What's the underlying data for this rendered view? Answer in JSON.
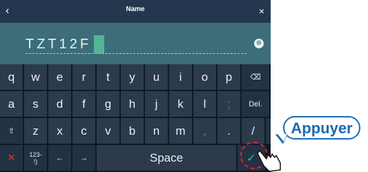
{
  "titlebar": {
    "back_icon": "chevron-left-icon",
    "back_glyph": "‹",
    "title": "Name",
    "close_icon": "close-icon",
    "close_glyph": "×"
  },
  "field": {
    "value": "TZT12F",
    "clear_icon": "clear-circle-icon",
    "clear_glyph": "⊗"
  },
  "keyboard": {
    "row1": [
      "q",
      "w",
      "e",
      "r",
      "t",
      "y",
      "u",
      "i",
      "o",
      "p"
    ],
    "backspace_glyph": "⌫",
    "row2": [
      "a",
      "s",
      "d",
      "f",
      "g",
      "h",
      "j",
      "k",
      "l",
      ";"
    ],
    "del_label": "Del.",
    "row3": [
      "z",
      "x",
      "c",
      "v",
      "b",
      "n",
      "m",
      ",",
      ".",
      "/"
    ],
    "shift_glyph": "⇧",
    "cancel_glyph": "×",
    "numsym_label": "123-\n!)",
    "left_glyph": "←",
    "right_glyph": "→",
    "space_label": "Space",
    "enter_glyph": "✓"
  },
  "callout": {
    "text": "Appuyer"
  },
  "colors": {
    "accent": "#1a6bb5",
    "confirm": "#31c17a",
    "cancel": "#e0303b",
    "field_bg": "#3c6d78"
  }
}
